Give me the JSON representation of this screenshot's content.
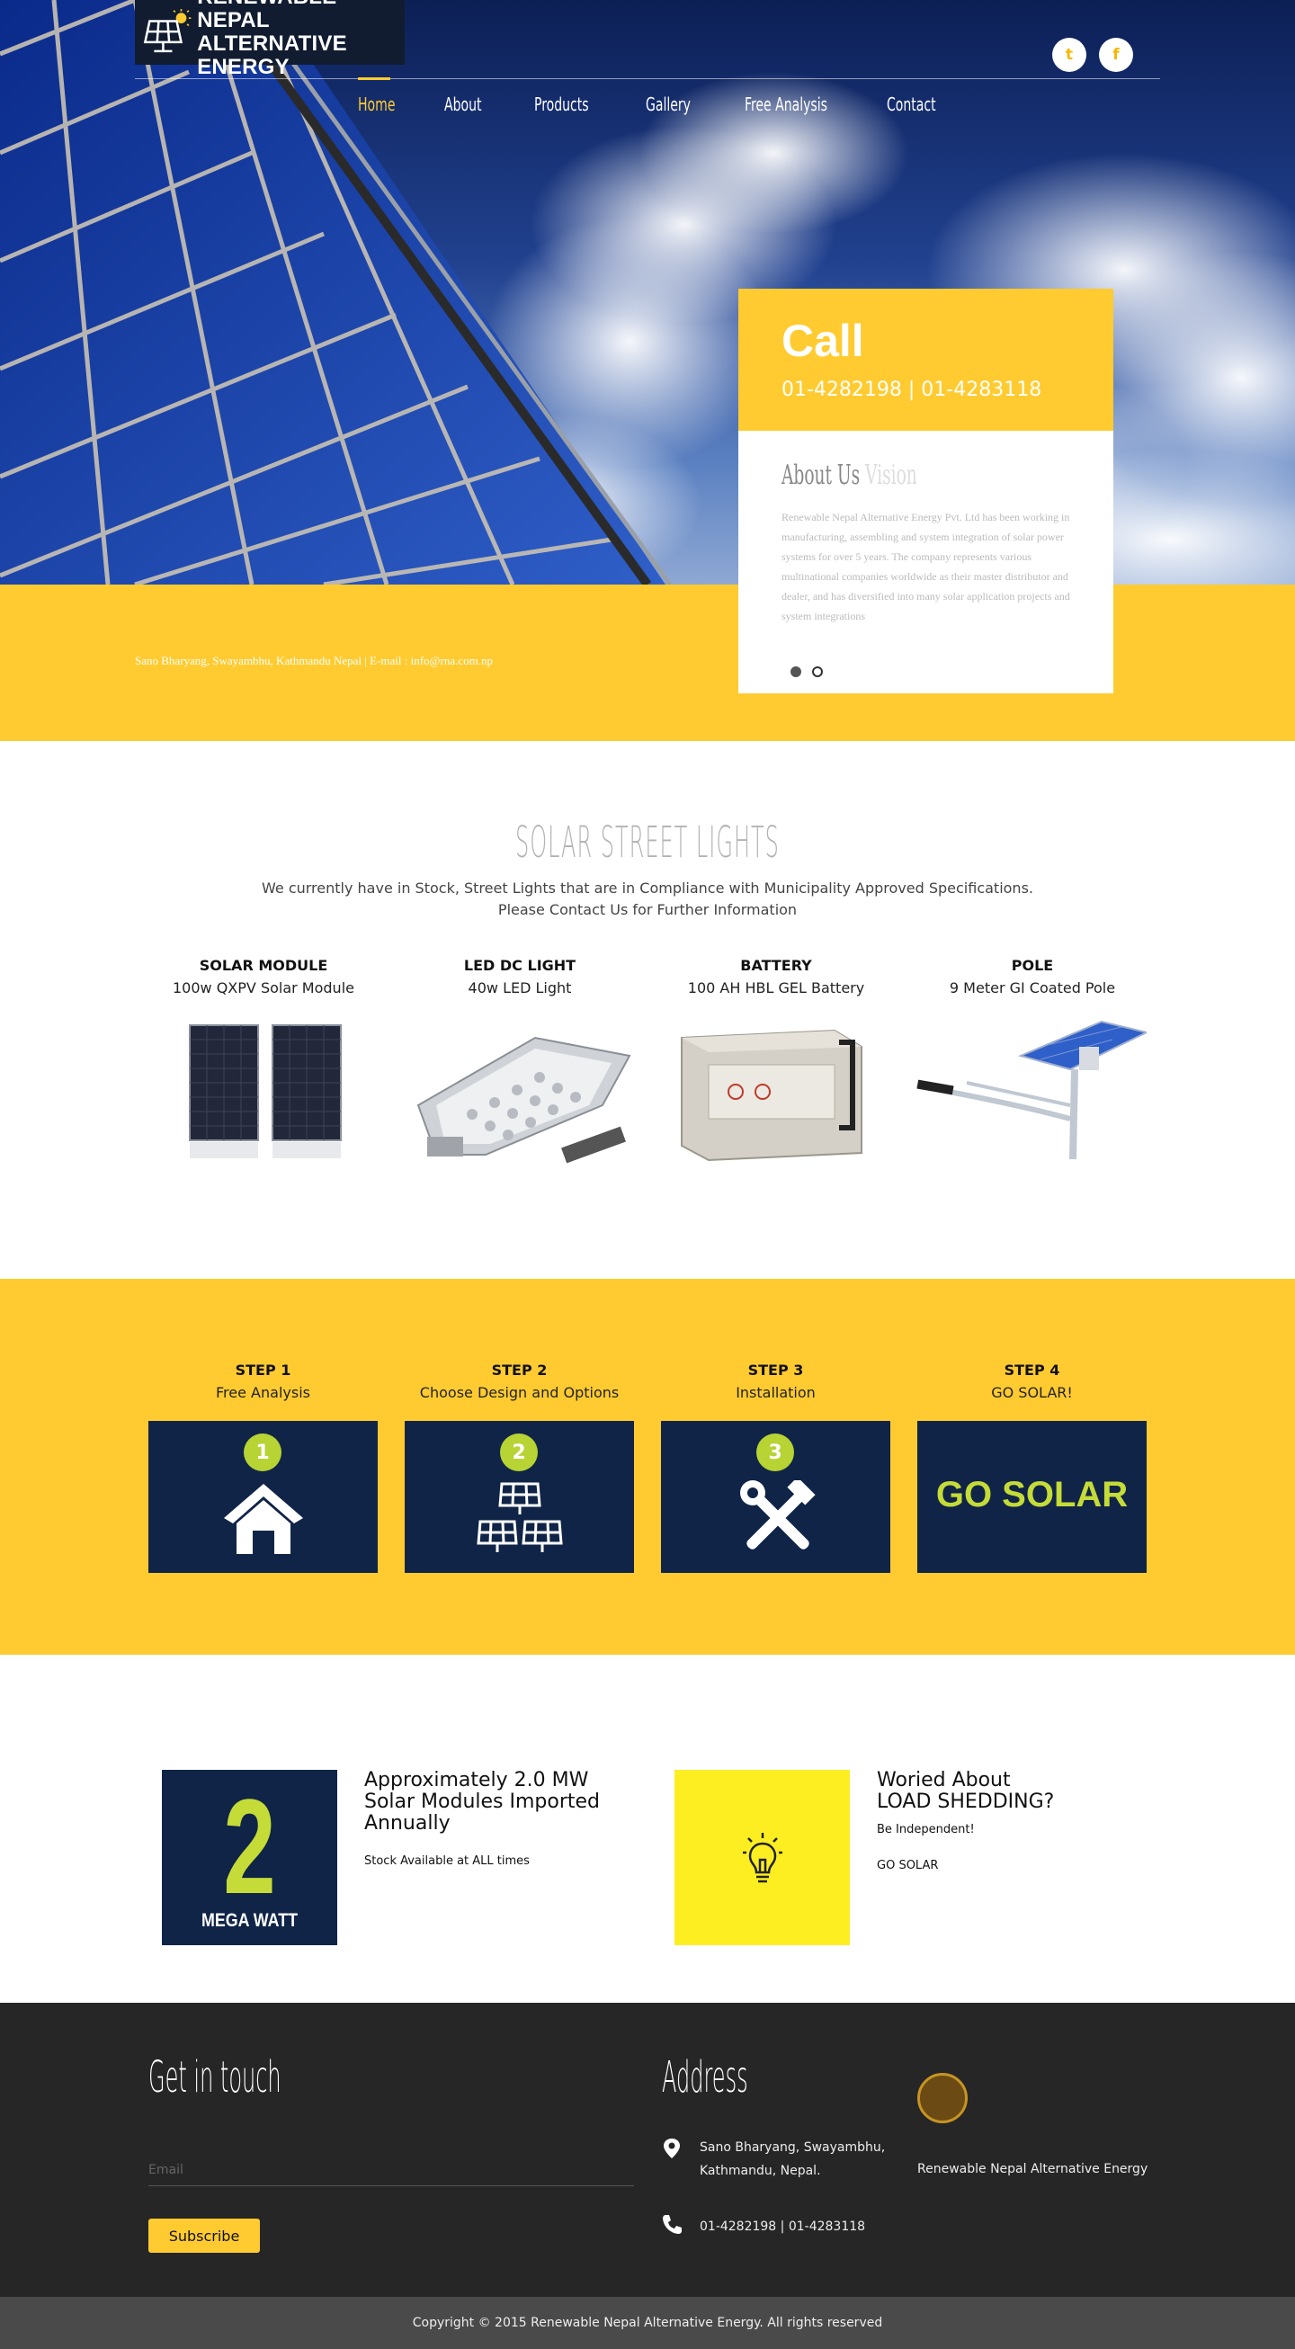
{
  "logo": {
    "line1": "RENEWABLE NEPAL",
    "line2": "ALTERNATIVE ENERGY"
  },
  "social": [
    {
      "icon": "twitter-icon",
      "glyph": "t"
    },
    {
      "icon": "facebook-icon",
      "glyph": "f"
    }
  ],
  "nav": [
    {
      "label": "Home",
      "active": true
    },
    {
      "label": "About"
    },
    {
      "label": "Products"
    },
    {
      "label": "Gallery"
    },
    {
      "label": "Free Analysis"
    },
    {
      "label": "Contact"
    }
  ],
  "call": {
    "title": "Call",
    "phones": "01-4282198 | 01-4283118"
  },
  "about": {
    "title": "About Us",
    "faint_title": "Vision",
    "text": "Renewable Nepal Alternative Energy Pvt. Ltd has been working in manufacturing, assembling and system integration of solar power systems for over 5 years. The company represents various multinational companies worldwide as their master distributor and dealer, and has diversified into many solar application projects and system integrations"
  },
  "contact_line": "Sano Bharyang, Swayambhu, Kathmandu Nepal | E-mail : info@rna.com.np",
  "street": {
    "title": "SOLAR STREET LIGHTS",
    "subtitle_line1": "We currently have in Stock, Street Lights that are in Compliance with Municipality Approved Specifications.",
    "subtitle_line2": "Please Contact Us for Further Information",
    "products": [
      {
        "title": "SOLAR MODULE",
        "sub": "100w QXPV Solar Module"
      },
      {
        "title": "LED DC LIGHT",
        "sub": "40w LED Light"
      },
      {
        "title": "BATTERY",
        "sub": "100 AH HBL GEL Battery"
      },
      {
        "title": "POLE",
        "sub": "9 Meter GI Coated Pole"
      }
    ]
  },
  "steps": [
    {
      "title": "STEP 1",
      "sub": "Free Analysis",
      "num": "1",
      "icon": "house-icon"
    },
    {
      "title": "STEP 2",
      "sub": "Choose Design and Options",
      "num": "2",
      "icon": "solar-panels-icon"
    },
    {
      "title": "STEP 3",
      "sub": "Installation",
      "num": "3",
      "icon": "tools-icon"
    },
    {
      "title": "STEP 4",
      "sub": "GO SOLAR!",
      "card_text": "GO SOLAR"
    }
  ],
  "info": {
    "mw_num": "2",
    "mw_label": "MEGA WATT",
    "left_head": "Approximately 2.0 MW Solar Modules Imported Annually",
    "left_text": "Stock Available at ALL times",
    "right_head_line1": "Woried About",
    "right_head_line2": "LOAD SHEDDING?",
    "right_text1": "Be Independent!",
    "right_text2": "GO SOLAR"
  },
  "footer": {
    "get_in_touch": "Get in touch",
    "email_placeholder": "Email",
    "subscribe": "Subscribe",
    "address_title": "Address",
    "address_line1": "Sano Bharyang, Swayambhu,",
    "address_line2": "Kathmandu, Nepal.",
    "phones": "01-4282198 | 01-4283118",
    "company": "Renewable Nepal Alternative Energy",
    "copyright": "Copyright © 2015 Renewable Nepal Alternative Energy. All rights reserved"
  }
}
